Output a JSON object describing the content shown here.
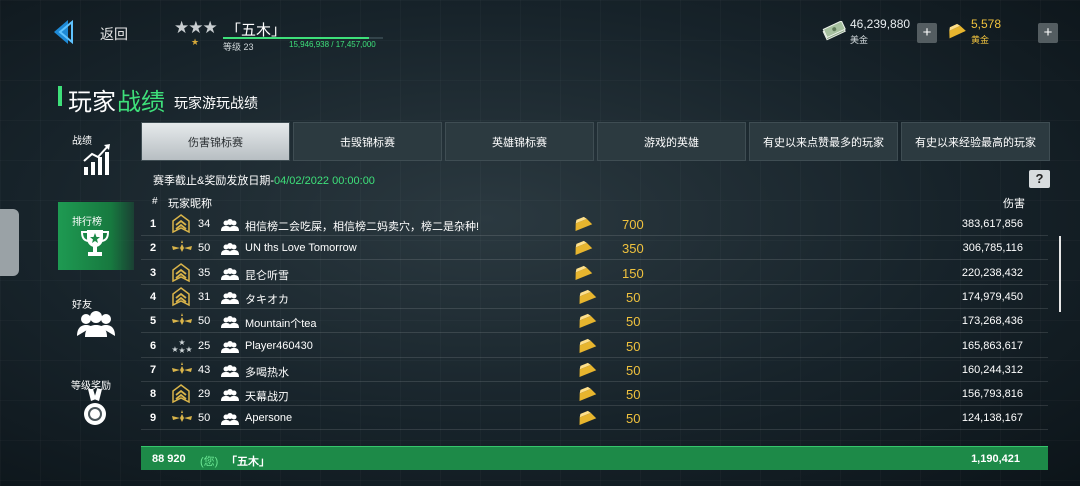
{
  "header": {
    "back_label": "返回",
    "stars": "★★★",
    "small_star": "★",
    "player_name": "「五木」",
    "level_label": "等级 23",
    "xp_text": "15,946,938 / 17,457,000",
    "xp_progress": 0.913,
    "cash_value": "46,239,880",
    "cash_label": "美金",
    "gold_value": "5,578",
    "gold_label": "黄金",
    "plus": "+"
  },
  "title": {
    "part1": "玩家",
    "part2": "战绩",
    "subtitle": "玩家游玩战绩"
  },
  "sidebar": {
    "items": [
      {
        "label": "战绩",
        "icon": "chart-up-icon"
      },
      {
        "label": "排行榜",
        "icon": "trophy-icon",
        "active": true
      },
      {
        "label": "好友",
        "icon": "friends-icon"
      },
      {
        "label": "等级奖励",
        "icon": "medal-icon"
      }
    ]
  },
  "tabs": [
    {
      "label": "伤害锦标赛",
      "active": true
    },
    {
      "label": "击毁锦标赛"
    },
    {
      "label": "英雄锦标赛"
    },
    {
      "label": "游戏的英雄"
    },
    {
      "label": "有史以来点赞最多的玩家"
    },
    {
      "label": "有史以来经验最高的玩家"
    }
  ],
  "season": {
    "label": "赛季截止&奖励发放日期-",
    "date": "04/02/2022 00:00:00"
  },
  "help_label": "?",
  "columns": {
    "hash": "#",
    "name": "玩家昵称",
    "damage": "伤害"
  },
  "rows": [
    {
      "rank": "1",
      "badge": "rank-chevron-badge",
      "level": "34",
      "name": "相信榜二会吃屎，相信榜二妈卖穴，榜二是杂种!",
      "reward": "700",
      "damage": "383,617,856"
    },
    {
      "rank": "2",
      "badge": "rank-wings-badge",
      "level": "50",
      "name": "UN ths Love Tomorrow",
      "reward": "350",
      "damage": "306,785,116"
    },
    {
      "rank": "3",
      "badge": "rank-chevron-badge",
      "level": "35",
      "name": "昆仑听雪",
      "reward": "150",
      "damage": "220,238,432"
    },
    {
      "rank": "4",
      "badge": "rank-chevron-badge",
      "level": "31",
      "name": "タキオカ",
      "reward": "50",
      "damage": "174,979,450"
    },
    {
      "rank": "5",
      "badge": "rank-wings-badge",
      "level": "50",
      "name": "Mountain个tea",
      "reward": "50",
      "damage": "173,268,436"
    },
    {
      "rank": "6",
      "badge": "rank-stars-badge",
      "level": "25",
      "name": "Player460430",
      "reward": "50",
      "damage": "165,863,617"
    },
    {
      "rank": "7",
      "badge": "rank-wings-badge",
      "level": "43",
      "name": "多喝热水",
      "reward": "50",
      "damage": "160,244,312"
    },
    {
      "rank": "8",
      "badge": "rank-chevron-badge",
      "level": "29",
      "name": "天幕战刃",
      "reward": "50",
      "damage": "156,793,816"
    },
    {
      "rank": "9",
      "badge": "rank-wings-badge",
      "level": "50",
      "name": "Apersone",
      "reward": "50",
      "damage": "124,138,167"
    }
  ],
  "self_row": {
    "rank": "88 920",
    "you": "(您)",
    "name": "「五木」",
    "damage": "1,190,421"
  },
  "colors": {
    "accent_green": "#3ee07a",
    "gold": "#f0c23e",
    "self_row": "#1d8a48"
  }
}
